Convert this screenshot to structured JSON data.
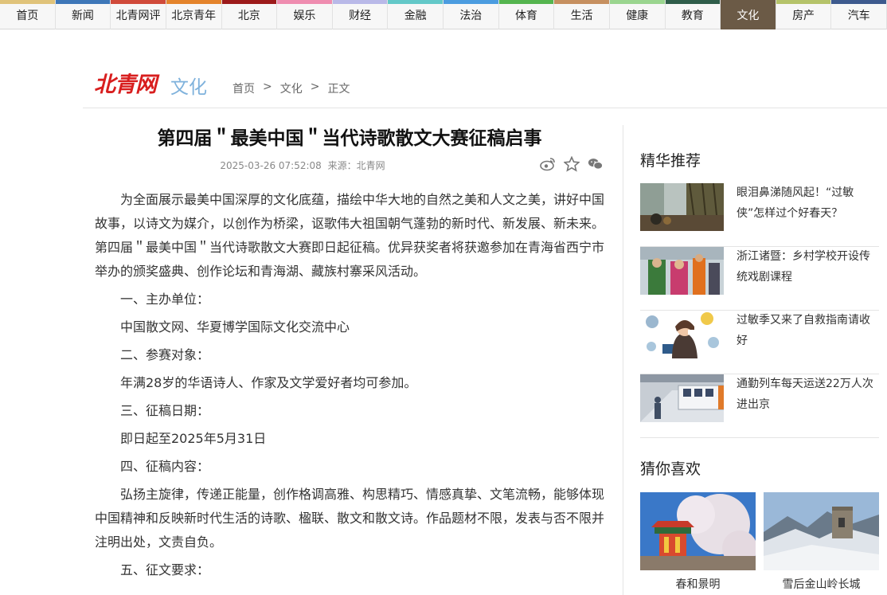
{
  "nav": [
    {
      "label": "首页",
      "color": "#e0c37a"
    },
    {
      "label": "新闻",
      "color": "#3e77b8"
    },
    {
      "label": "北青网评",
      "color": "#d04a3a"
    },
    {
      "label": "北京青年",
      "color": "#e4842c"
    },
    {
      "label": "北京",
      "color": "#9c1a1a"
    },
    {
      "label": "娱乐",
      "color": "#ef8db0"
    },
    {
      "label": "财经",
      "color": "#b9b9e8"
    },
    {
      "label": "金融",
      "color": "#63c8c8"
    },
    {
      "label": "法治",
      "color": "#4b9ce0"
    },
    {
      "label": "体育",
      "color": "#55b54f"
    },
    {
      "label": "生活",
      "color": "#c69060"
    },
    {
      "label": "健康",
      "color": "#9ad58f"
    },
    {
      "label": "教育",
      "color": "#2f5d4a"
    },
    {
      "label": "文化",
      "color": "#6b5a46",
      "active": true
    },
    {
      "label": "房产",
      "color": "#b5c36a"
    },
    {
      "label": "汽车",
      "color": "#3d5a8e"
    }
  ],
  "header": {
    "logo": "北青网",
    "channel": "文化",
    "breadcrumb": [
      "首页",
      "文化",
      "正文"
    ],
    "breadcrumb_sep": ">"
  },
  "article": {
    "title": "第四届＂最美中国＂当代诗歌散文大赛征稿启事",
    "datetime": "2025-03-26 07:52:08",
    "source": "来源：北青网",
    "share_icons": [
      "weibo-icon",
      "star-icon",
      "wechat-icon"
    ],
    "paragraphs": [
      "为全面展示最美中国深厚的文化底蕴，描绘中华大地的自然之美和人文之美，讲好中国故事，以诗文为媒介，以创作为桥梁，讴歌伟大祖国朝气蓬勃的新时代、新发展、新未来。第四届＂最美中国＂当代诗歌散文大赛即日起征稿。优异获奖者将获邀参加在青海省西宁市举办的颁奖盛典、创作论坛和青海湖、藏族村寨采风活动。",
      "一、主办单位：",
      "中国散文网、华夏博学国际文化交流中心",
      "二、参赛对象：",
      "年满28岁的华语诗人、作家及文学爱好者均可参加。",
      "三、征稿日期：",
      "即日起至2025年5月31日",
      "四、征稿内容：",
      "弘扬主旋律，传递正能量，创作格调高雅、构思精巧、情感真挚、文笔流畅，能够体现中国精神和反映新时代生活的诗歌、楹联、散文和散文诗。作品题材不限，发表与否不限并注明出处，文责自负。",
      "五、征文要求："
    ]
  },
  "sidebar": {
    "featured_title": "精华推荐",
    "featured": [
      {
        "title": "眼泪鼻涕随风起！“过敏侠”怎样过个好春天？"
      },
      {
        "title": "浙江诸暨：乡村学校开设传统戏剧课程"
      },
      {
        "title": "过敏季又来了自救指南请收好"
      },
      {
        "title": "通勤列车每天运送22万人次进出京"
      }
    ],
    "guess_title": "猜你喜欢",
    "guess": [
      {
        "caption": "春和景明"
      },
      {
        "caption": "雪后金山岭长城"
      }
    ]
  }
}
